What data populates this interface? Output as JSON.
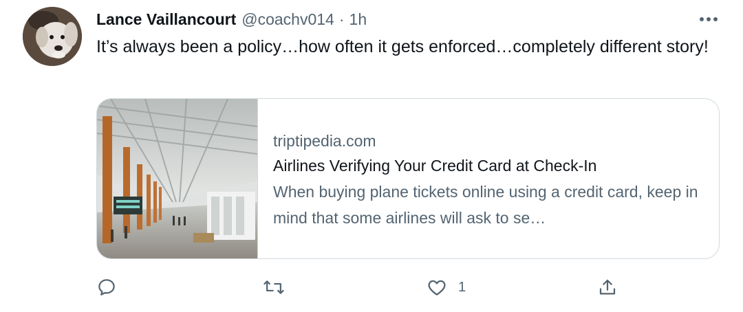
{
  "tweet": {
    "author_name": "Lance Vaillancourt",
    "handle": "@coachv014",
    "separator": "·",
    "time": "1h",
    "text": "It’s always been a policy…how often it gets enforced…completely different story!",
    "avatar_icon": "dog-avatar",
    "more_icon": "more-horizontal-icon"
  },
  "card": {
    "domain": "triptipedia.com",
    "title": "Airlines Verifying Your Credit Card at Check-In",
    "description": "When buying plane tickets online using a credit card, keep in mind that some airlines will ask to se…",
    "image": "airport-terminal-photo"
  },
  "actions": {
    "reply_icon": "reply-icon",
    "retweet_icon": "retweet-icon",
    "like_icon": "heart-icon",
    "like_count": "1",
    "share_icon": "share-icon"
  },
  "colors": {
    "text_primary": "#0f1419",
    "text_secondary": "#536471",
    "border": "#cfd9de"
  }
}
